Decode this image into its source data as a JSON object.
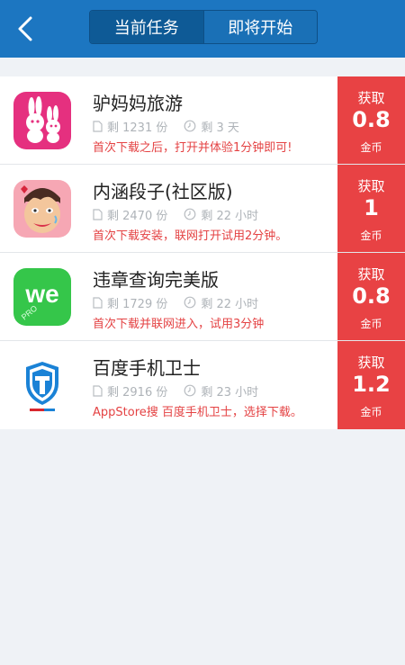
{
  "header": {
    "tabs": [
      {
        "label": "当前任务"
      },
      {
        "label": "即将开始"
      }
    ]
  },
  "tasks": [
    {
      "name": "驴妈妈旅游",
      "remaining": "剩 1231 份",
      "time_left": "剩 3 天",
      "instruction": "首次下载之后，打开并体验1分钟即可!",
      "reward_label": "获取",
      "reward_amount": "0.8",
      "reward_unit": "金币",
      "icon": "rabbits-icon"
    },
    {
      "name": "内涵段子(社区版)",
      "remaining": "剩 2470 份",
      "time_left": "剩 22 小时",
      "instruction": "首次下载安装，联网打开试用2分钟。",
      "reward_label": "获取",
      "reward_amount": "1",
      "reward_unit": "金币",
      "icon": "cartoon-face-icon"
    },
    {
      "name": "违章查询完美版",
      "remaining": "剩 1729 份",
      "time_left": "剩 22 小时",
      "instruction": "首次下载并联网进入，试用3分钟",
      "reward_label": "获取",
      "reward_amount": "0.8",
      "reward_unit": "金币",
      "icon": "we-pro-icon"
    },
    {
      "name": "百度手机卫士",
      "remaining": "剩 2916 份",
      "time_left": "剩 23 小时",
      "instruction": "AppStore搜 百度手机卫士，选择下载。",
      "reward_label": "获取",
      "reward_amount": "1.2",
      "reward_unit": "金币",
      "icon": "shield-icon"
    }
  ],
  "colors": {
    "header": "#1c76c1",
    "reward": "#e84244",
    "instruction": "#e44243"
  }
}
